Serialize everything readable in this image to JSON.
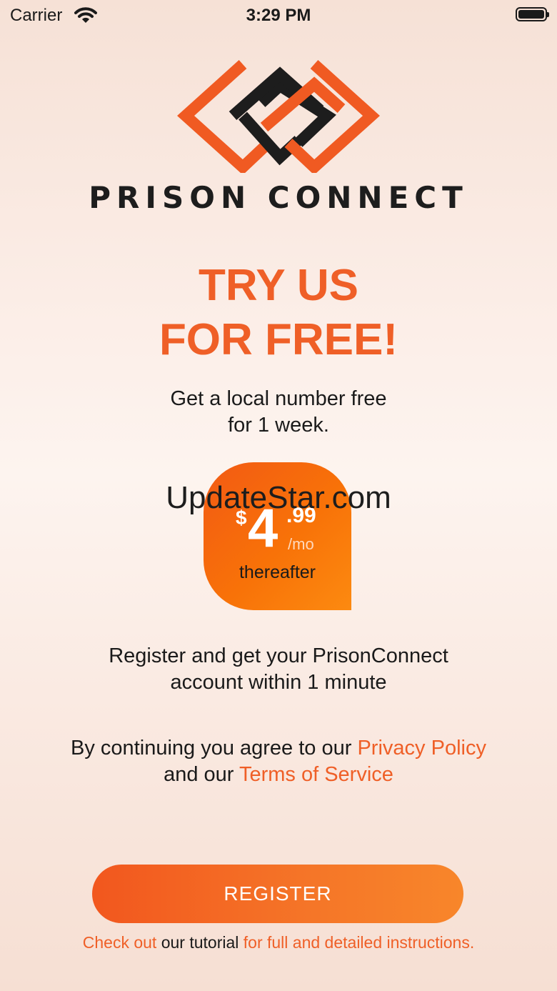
{
  "status_bar": {
    "carrier": "Carrier",
    "time": "3:29 PM"
  },
  "brand": {
    "name": "PRISON CONNECT"
  },
  "promo": {
    "headline_line1": "TRY US",
    "headline_line2": "FOR FREE!",
    "subtext_line1": "Get a local number free",
    "subtext_line2": "for 1 week."
  },
  "price": {
    "currency": "$",
    "amount": "4",
    "cents": ".99",
    "period": "/mo",
    "note": "thereafter"
  },
  "watermark": "UpdateStar.com",
  "register_info": {
    "line1": "Register and get your PrisonConnect",
    "line2": "account within 1 minute"
  },
  "legal": {
    "prefix": "By continuing you agree to our ",
    "privacy_link": "Privacy Policy",
    "middle": "and our ",
    "terms_link": "Terms of Service"
  },
  "register_button": {
    "label": "REGISTER"
  },
  "tutorial": {
    "link1": "Check out",
    "middle": " our tutorial ",
    "link2": "for full and detailed instructions."
  },
  "colors": {
    "accent": "#ef5f27",
    "badge": "#f56b10",
    "text": "#1a1a1a"
  },
  "icons": [
    "wifi-icon",
    "battery-icon",
    "prison-connect-logo-icon"
  ]
}
